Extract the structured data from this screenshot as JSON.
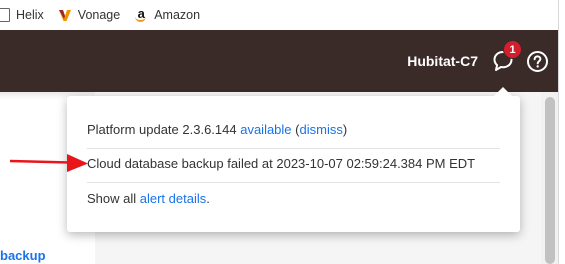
{
  "bookmarks": [
    {
      "label": "Helix",
      "icon": "page-icon"
    },
    {
      "label": "Vonage",
      "icon": "vonage-icon"
    },
    {
      "label": "Amazon",
      "icon": "amazon-icon"
    }
  ],
  "header": {
    "hub_name": "Hubitat-C7",
    "notification_count": "1",
    "notification_icon": "chat-bubble-icon",
    "help_icon": "help-icon"
  },
  "page": {
    "backup_link": "backup"
  },
  "notifications": {
    "update_text": "Platform update 2.3.6.144 ",
    "available_link": "available",
    "paren_open": " (",
    "dismiss_link": "dismiss",
    "paren_close": ")",
    "backup_failed": "Cloud database backup failed at 2023-10-07 02:59:24.384 PM EDT",
    "show_all_text": "Show all ",
    "alert_details_link": "alert details",
    "period": "."
  },
  "colors": {
    "header_bg": "#3a2a28",
    "badge": "#d21f2e",
    "link": "#1a73e8",
    "annotation_arrow": "#e8161b"
  }
}
